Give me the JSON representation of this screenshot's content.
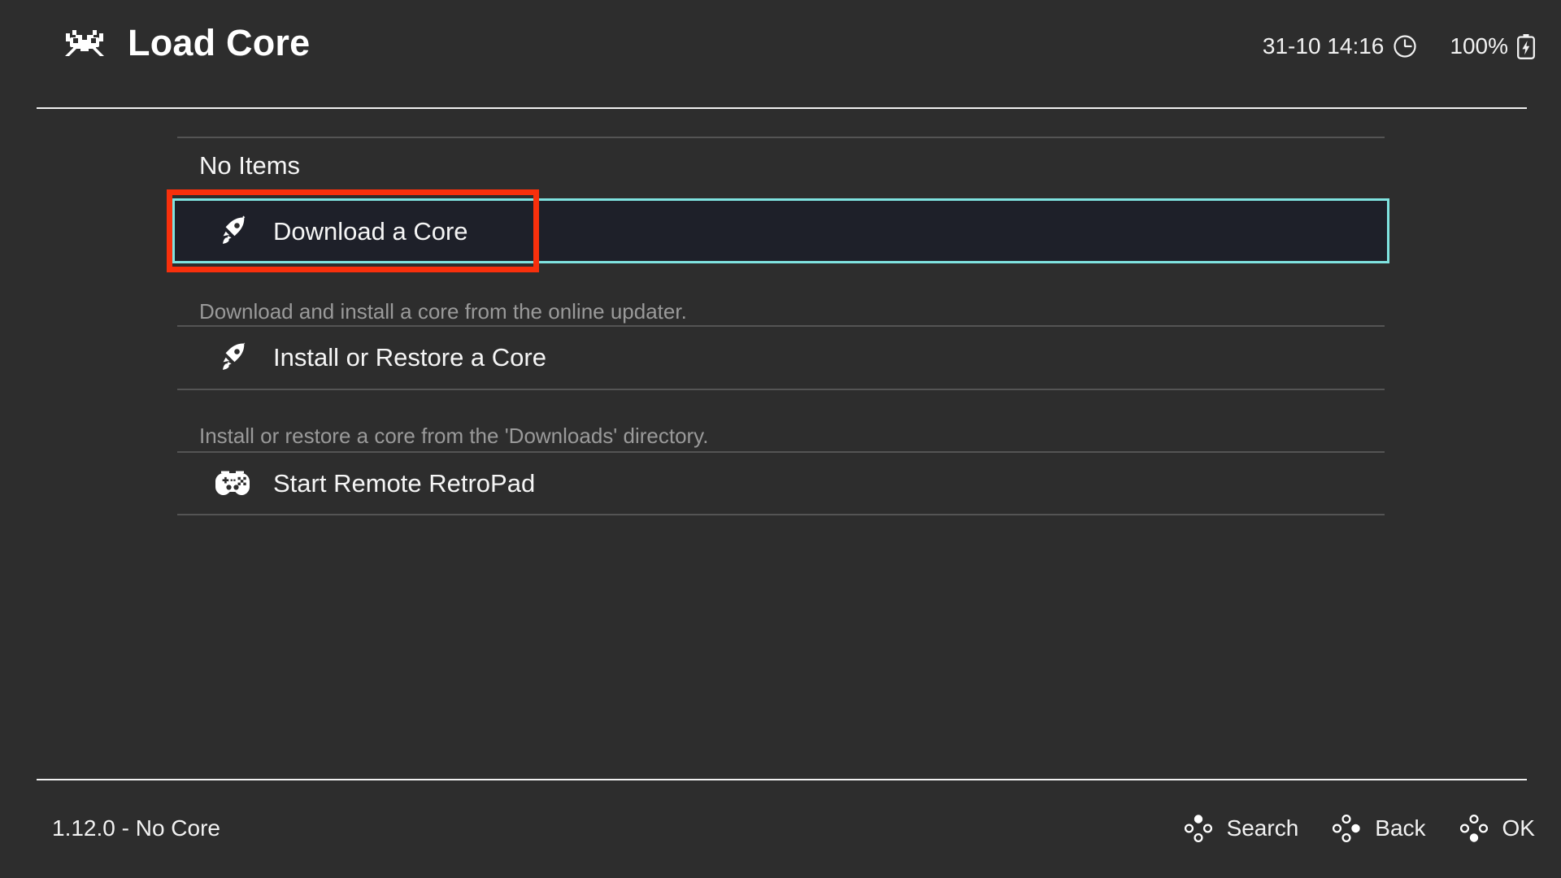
{
  "header": {
    "logo_icon": "retroarch-invader-icon",
    "title": "Load Core",
    "datetime": "31-10 14:16",
    "clock_icon": "clock-icon",
    "battery_percent": "100%",
    "battery_icon": "battery-charging-icon"
  },
  "main": {
    "empty_label": "No Items",
    "items": [
      {
        "icon": "rocket-icon",
        "label": "Download a Core",
        "sublabel": "Download and install a core from the online updater.",
        "selected": true
      },
      {
        "icon": "rocket-icon",
        "label": "Install or Restore a Core",
        "sublabel": "Install or restore a core from the 'Downloads' directory.",
        "selected": false
      },
      {
        "icon": "gamepad-icon",
        "label": "Start Remote RetroPad",
        "sublabel": "",
        "selected": false
      }
    ]
  },
  "footer": {
    "version": "1.12.0 - No Core",
    "actions": [
      {
        "icon": "gamepad-cluster-up-icon",
        "label": "Search"
      },
      {
        "icon": "gamepad-cluster-right-icon",
        "label": "Back"
      },
      {
        "icon": "gamepad-cluster-down-icon",
        "label": "OK"
      }
    ]
  },
  "colors": {
    "background": "#2d2d2d",
    "selection_border": "#7fe3e0",
    "selection_fill": "#1e2029",
    "annotation": "#f8300c",
    "text_primary": "#f5f5f5",
    "text_dim": "#9a9a9a",
    "separator": "#545454",
    "rule": "#f0f0f0"
  }
}
